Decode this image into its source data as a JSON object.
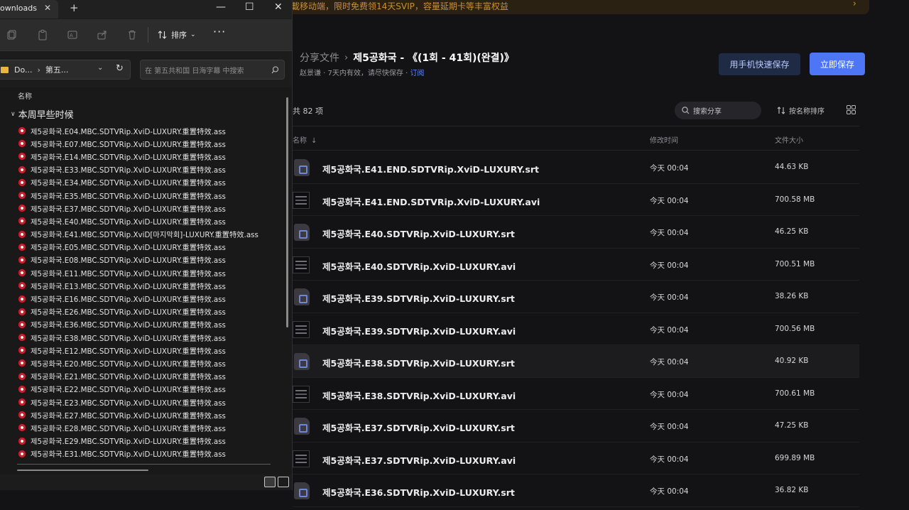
{
  "web": {
    "banner_text": "載移动端，限时免费领14天SVIP，容量延期卡等丰富权益",
    "breadcrumb": {
      "root": "分享文件",
      "separator": "›",
      "current": "제5공화국 - 《(1회 - 41회)(완결)》"
    },
    "sharer": {
      "text": "赵景谦 · 7天内有效，请尽快保存 · ",
      "subscribe": "订阅"
    },
    "buttons": {
      "phone_save": "用手机快速保存",
      "save_now": "立即保存"
    },
    "total": "共 82 项",
    "search_placeholder": "搜索分享",
    "sort_label": "按名称排序",
    "columns": {
      "name": "名称",
      "modified": "修改时间",
      "size": "文件大小"
    },
    "files": [
      {
        "name": "제5공화국.E41.END.SDTVRip.XviD-LUXURY.srt",
        "type": "srt",
        "date": "今天 00:04",
        "size": "44.63 KB"
      },
      {
        "name": "제5공화국.E41.END.SDTVRip.XviD-LUXURY.avi",
        "type": "avi",
        "date": "今天 00:04",
        "size": "700.58 MB"
      },
      {
        "name": "제5공화국.E40.SDTVRip.XviD-LUXURY.srt",
        "type": "srt",
        "date": "今天 00:04",
        "size": "46.25 KB"
      },
      {
        "name": "제5공화국.E40.SDTVRip.XviD-LUXURY.avi",
        "type": "avi",
        "date": "今天 00:04",
        "size": "700.51 MB"
      },
      {
        "name": "제5공화국.E39.SDTVRip.XviD-LUXURY.srt",
        "type": "srt",
        "date": "今天 00:04",
        "size": "38.26 KB"
      },
      {
        "name": "제5공화국.E39.SDTVRip.XviD-LUXURY.avi",
        "type": "avi",
        "date": "今天 00:04",
        "size": "700.56 MB"
      },
      {
        "name": "제5공화국.E38.SDTVRip.XviD-LUXURY.srt",
        "type": "srt",
        "date": "今天 00:04",
        "size": "40.92 KB",
        "highlighted": true
      },
      {
        "name": "제5공화국.E38.SDTVRip.XviD-LUXURY.avi",
        "type": "avi",
        "date": "今天 00:04",
        "size": "700.61 MB"
      },
      {
        "name": "제5공화국.E37.SDTVRip.XviD-LUXURY.srt",
        "type": "srt",
        "date": "今天 00:04",
        "size": "47.25 KB"
      },
      {
        "name": "제5공화국.E37.SDTVRip.XviD-LUXURY.avi",
        "type": "avi",
        "date": "今天 00:04",
        "size": "699.89 MB"
      },
      {
        "name": "제5공화국.E36.SDTVRip.XviD-LUXURY.srt",
        "type": "srt",
        "date": "今天 00:04",
        "size": "36.82 KB"
      }
    ]
  },
  "explorer": {
    "tab_title": "ownloads\\",
    "toolbar": {
      "sort_label": "排序",
      "more": "···"
    },
    "address": {
      "part1": "Do...",
      "part2": "第五..."
    },
    "search_placeholder": "在 第五共和国 日海字幕 中搜索",
    "column_name": "名称",
    "group_label": "本周早些时候",
    "files": [
      "제5공화국.E04.MBC.SDTVRip.XviD-LUXURY.重置特效.ass",
      "제5공화국.E07.MBC.SDTVRip.XviD-LUXURY.重置特效.ass",
      "제5공화국.E14.MBC.SDTVRip.XviD-LUXURY.重置特效.ass",
      "제5공화국.E33.MBC.SDTVRip.XviD-LUXURY.重置特效.ass",
      "제5공화국.E34.MBC.SDTVRip.XviD-LUXURY.重置特效.ass",
      "제5공화국.E35.MBC.SDTVRip.XviD-LUXURY.重置特效.ass",
      "제5공화국.E37.MBC.SDTVRip.XviD-LUXURY.重置特效.ass",
      "제5공화국.E40.MBC.SDTVRip.XviD-LUXURY.重置特效.ass",
      "제5공화국.E41.MBC.SDTVRip.XviD[마지막회]-LUXURY.重置特效.ass",
      "제5공화국.E05.MBC.SDTVRip.XviD-LUXURY.重置特效.ass",
      "제5공화국.E08.MBC.SDTVRip.XviD-LUXURY.重置特效.ass",
      "제5공화국.E11.MBC.SDTVRip.XviD-LUXURY.重置特效.ass",
      "제5공화국.E13.MBC.SDTVRip.XviD-LUXURY.重置特效.ass",
      "제5공화국.E16.MBC.SDTVRip.XviD-LUXURY.重置特效.ass",
      "제5공화국.E26.MBC.SDTVRip.XviD-LUXURY.重置特效.ass",
      "제5공화국.E36.MBC.SDTVRip.XviD-LUXURY.重置特效.ass",
      "제5공화국.E38.MBC.SDTVRip.XviD-LUXURY.重置特效.ass",
      "제5공화국.E12.MBC.SDTVRip.XviD-LUXURY.重置特效.ass",
      "제5공화국.E20.MBC.SDTVRip.XviD-LUXURY.重置特效.ass",
      "제5공화국.E21.MBC.SDTVRip.XviD-LUXURY.重置特效.ass",
      "제5공화국.E22.MBC.SDTVRip.XviD-LUXURY.重置特效.ass",
      "제5공화국.E23.MBC.SDTVRip.XviD-LUXURY.重置特效.ass",
      "제5공화국.E27.MBC.SDTVRip.XviD-LUXURY.重置特效.ass",
      "제5공화국.E28.MBC.SDTVRip.XviD-LUXURY.重置特效.ass",
      "제5공화국.E29.MBC.SDTVRip.XviD-LUXURY.重置特效.ass",
      "제5공화국.E31.MBC.SDTVRip.XviD-LUXURY.重置特效.ass"
    ]
  },
  "colors": {
    "accent": "#4d75f5",
    "banner_text": "#c98f35",
    "folder": "#e8b73c"
  }
}
